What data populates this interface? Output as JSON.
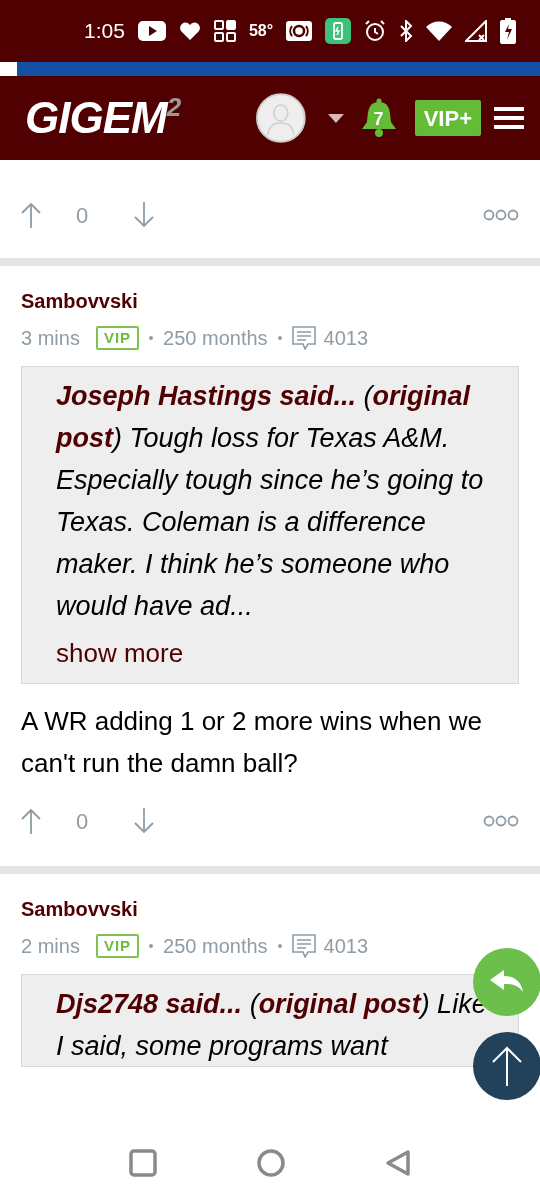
{
  "status_bar": {
    "time": "1:05",
    "temperature": "58°"
  },
  "header": {
    "logo": "GIGEM",
    "logo_mark": "2",
    "notifications": "7",
    "vip_button": "VIP+"
  },
  "previous_post": {
    "score": "0"
  },
  "posts": [
    {
      "author": "Sambovvski",
      "time": "3 mins",
      "badge": "VIP",
      "tenure": "250 months",
      "post_count": "4013",
      "quote": {
        "text": "**Joseph Hastings said...** (**original post**) Tough loss for Texas A&M. Especially tough since he’s going to Texas. Coleman is a difference maker. I think he’s someone who would have ad...",
        "show_more": "show more"
      },
      "body": "A WR adding 1 or 2 more wins when we can't run the damn ball?",
      "score": "0"
    },
    {
      "author": "Sambovvski",
      "time": "2 mins",
      "badge": "VIP",
      "tenure": "250 months",
      "post_count": "4013",
      "quote": {
        "text": "**Djs2748 said...** (**original post**) Like I said, some programs want"
      }
    }
  ]
}
